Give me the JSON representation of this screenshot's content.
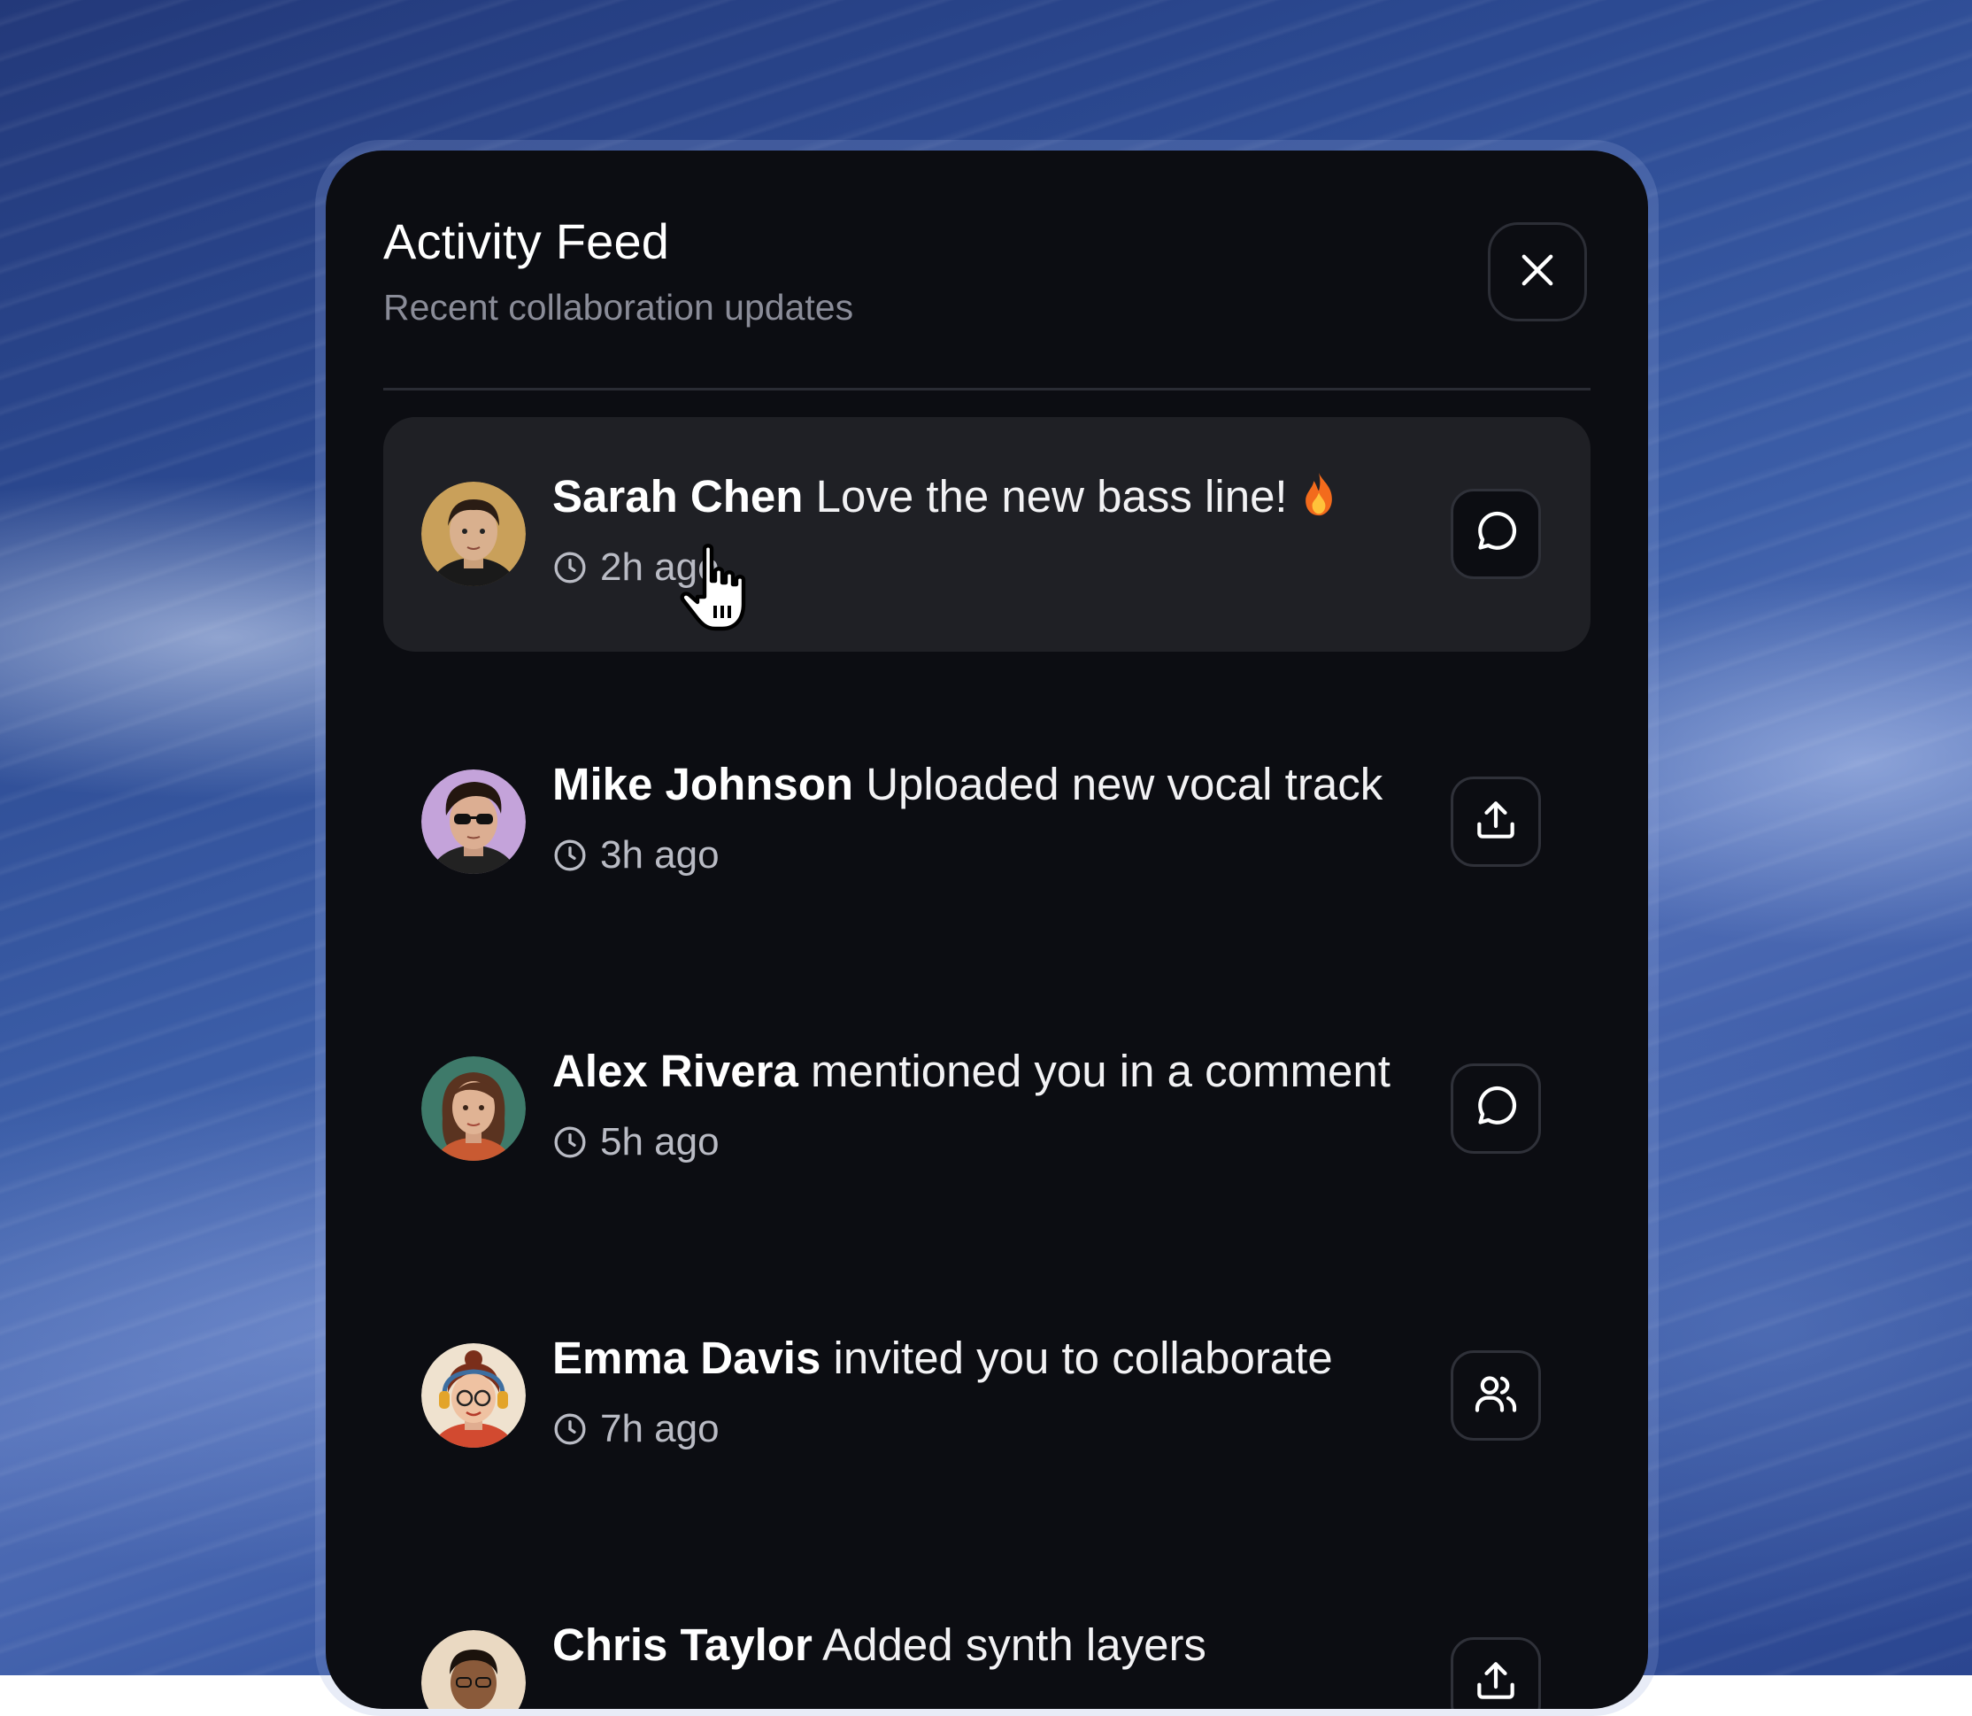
{
  "panel": {
    "title": "Activity Feed",
    "subtitle": "Recent collaboration updates"
  },
  "icons": {
    "close": "close-icon",
    "comment": "message-bubble-icon",
    "upload": "upload-icon",
    "users": "users-icon",
    "clock": "clock-icon"
  },
  "colors": {
    "panel_bg": "#0c0d12",
    "active_row_bg": "#1f2025",
    "text_primary": "#ffffff",
    "text_muted": "#8a8c98",
    "border": "#2c2e36"
  },
  "feed": [
    {
      "name": "Sarah Chen",
      "message": "Love the new bass line!",
      "emoji": "🔥",
      "time": "2h ago",
      "action": "comment",
      "active": true
    },
    {
      "name": "Mike Johnson",
      "message": "Uploaded new vocal track",
      "time": "3h ago",
      "action": "upload",
      "active": false
    },
    {
      "name": "Alex Rivera",
      "message": "mentioned you in a comment",
      "time": "5h ago",
      "action": "comment",
      "active": false
    },
    {
      "name": "Emma Davis",
      "message": "invited you to collaborate",
      "time": "7h ago",
      "action": "users",
      "active": false
    },
    {
      "name": "Chris Taylor",
      "message": "Added synth layers",
      "time": "",
      "action": "upload",
      "active": false
    }
  ]
}
